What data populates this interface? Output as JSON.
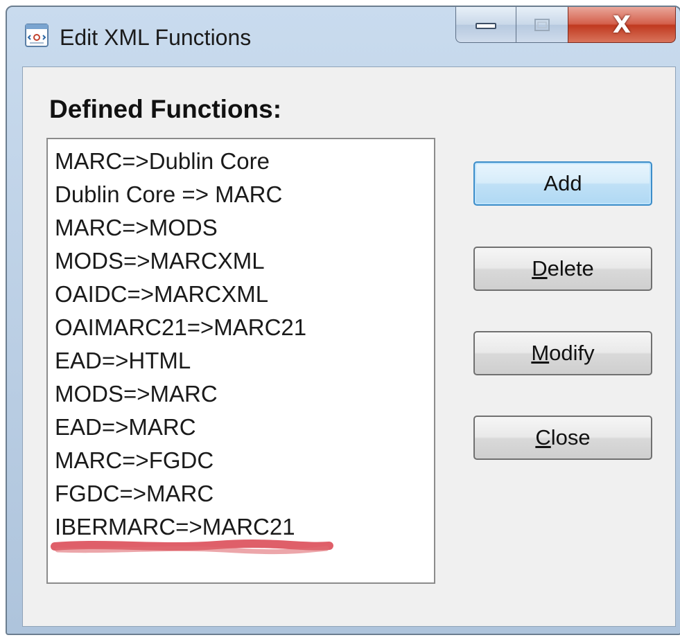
{
  "window": {
    "title": "Edit XML Functions",
    "icon": "xml-document-icon",
    "controls": {
      "minimize": "minimize-icon",
      "maximize": "maximize-icon",
      "close": "X"
    }
  },
  "section_label": "Defined Functions:",
  "functions": [
    "MARC=>Dublin Core",
    "Dublin Core => MARC",
    "MARC=>MODS",
    "MODS=>MARCXML",
    "OAIDC=>MARCXML",
    "OAIMARC21=>MARC21",
    "EAD=>HTML",
    "MODS=>MARC",
    "EAD=>MARC",
    "MARC=>FGDC",
    "FGDC=>MARC",
    "IBERMARC=>MARC21"
  ],
  "buttons": {
    "add": {
      "label": "Add"
    },
    "delete": {
      "mnemonic": "D",
      "rest": "elete"
    },
    "modify": {
      "mnemonic": "M",
      "rest": "odify"
    },
    "close": {
      "mnemonic": "C",
      "rest": "lose"
    }
  },
  "colors": {
    "annotation": "#d9434f",
    "default_button_border": "#3c8dc9",
    "close_button": "#c0391f"
  }
}
